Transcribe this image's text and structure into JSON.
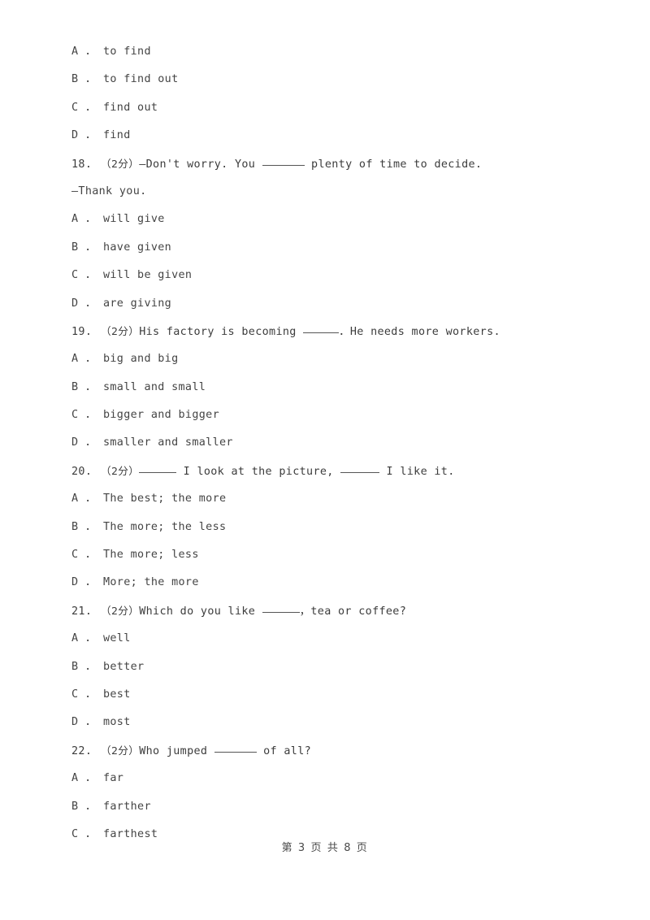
{
  "document": {
    "page_label": "第 3 页 共 8 页",
    "page_number": 3,
    "total_pages": 8,
    "text_color": "#444444",
    "background_color": "#ffffff"
  },
  "lines": [
    {
      "id": "l1",
      "kind": "option",
      "text": "A ． to find"
    },
    {
      "id": "l2",
      "kind": "option",
      "text": "B ． to find out"
    },
    {
      "id": "l3",
      "kind": "option",
      "text": "C ． find out"
    },
    {
      "id": "l4",
      "kind": "option",
      "text": "D ． find"
    },
    {
      "id": "l5",
      "kind": "question",
      "number": "18.",
      "marks": "（2分）",
      "pre": "—Don't worry. You ",
      "blank": "w1",
      "post": " plenty of time to decide."
    },
    {
      "id": "l6",
      "kind": "text",
      "text": "—Thank you."
    },
    {
      "id": "l7",
      "kind": "option",
      "text": "A ． will give"
    },
    {
      "id": "l8",
      "kind": "option",
      "text": "B ． have given"
    },
    {
      "id": "l9",
      "kind": "option",
      "text": "C ． will be given"
    },
    {
      "id": "l10",
      "kind": "option",
      "text": "D ． are giving"
    },
    {
      "id": "l11",
      "kind": "question",
      "number": "19.",
      "marks": "（2分）",
      "pre": "His factory is becoming ",
      "blank": "w2",
      "post": "．He needs more workers."
    },
    {
      "id": "l12",
      "kind": "option",
      "text": "A ． big and big"
    },
    {
      "id": "l13",
      "kind": "option",
      "text": "B ． small and small"
    },
    {
      "id": "l14",
      "kind": "option",
      "text": "C ． bigger and bigger"
    },
    {
      "id": "l15",
      "kind": "option",
      "text": "D ． smaller and smaller"
    },
    {
      "id": "l16",
      "kind": "question2",
      "number": "20.",
      "marks": "（2分）",
      "pre": "",
      "blank": "w3",
      "mid": " I look at the picture, ",
      "blank2": "w4",
      "post": " I like it."
    },
    {
      "id": "l17",
      "kind": "option",
      "text": "A ． The best; the more"
    },
    {
      "id": "l18",
      "kind": "option",
      "text": "B ． The more; the less"
    },
    {
      "id": "l19",
      "kind": "option",
      "text": "C ． The more; less"
    },
    {
      "id": "l20",
      "kind": "option",
      "text": "D ． More; the more"
    },
    {
      "id": "l21",
      "kind": "question",
      "number": "21.",
      "marks": "（2分）",
      "pre": "Which do you like ",
      "blank": "w3",
      "post": "，tea or coffee?"
    },
    {
      "id": "l22",
      "kind": "option",
      "text": "A ． well"
    },
    {
      "id": "l23",
      "kind": "option",
      "text": "B ． better"
    },
    {
      "id": "l24",
      "kind": "option",
      "text": "C ． best"
    },
    {
      "id": "l25",
      "kind": "option",
      "text": "D ． most"
    },
    {
      "id": "l26",
      "kind": "question",
      "number": "22.",
      "marks": "（2分）",
      "pre": "Who jumped ",
      "blank": "w1",
      "post": " of all?"
    },
    {
      "id": "l27",
      "kind": "option",
      "text": "A ． far"
    },
    {
      "id": "l28",
      "kind": "option",
      "text": "B ． farther"
    },
    {
      "id": "l29",
      "kind": "option",
      "text": "C ． farthest"
    }
  ],
  "questions": [
    {
      "number": "18.",
      "marks": "（2分）",
      "stem": "—Don't worry. You ______ plenty of time to decide.",
      "stem_line2": "—Thank you.",
      "options": [
        {
          "letter": "A",
          "text": "will give"
        },
        {
          "letter": "B",
          "text": "have given"
        },
        {
          "letter": "C",
          "text": "will be given"
        },
        {
          "letter": "D",
          "text": "are giving"
        }
      ]
    },
    {
      "number": "19.",
      "marks": "（2分）",
      "stem": "His factory is becoming ______．He needs more workers.",
      "options": [
        {
          "letter": "A",
          "text": "big and big"
        },
        {
          "letter": "B",
          "text": "small and small"
        },
        {
          "letter": "C",
          "text": "bigger and bigger"
        },
        {
          "letter": "D",
          "text": "smaller and smaller"
        }
      ]
    },
    {
      "number": "20.",
      "marks": "（2分）",
      "stem": "______ I look at the picture, ______ I like it.",
      "options": [
        {
          "letter": "A",
          "text": "The best; the more"
        },
        {
          "letter": "B",
          "text": "The more; the less"
        },
        {
          "letter": "C",
          "text": "The more; less"
        },
        {
          "letter": "D",
          "text": "More; the more"
        }
      ]
    },
    {
      "number": "21.",
      "marks": "（2分）",
      "stem": "Which do you like ______，tea or coffee?",
      "options": [
        {
          "letter": "A",
          "text": "well"
        },
        {
          "letter": "B",
          "text": "better"
        },
        {
          "letter": "C",
          "text": "best"
        },
        {
          "letter": "D",
          "text": "most"
        }
      ]
    },
    {
      "number": "22.",
      "marks": "（2分）",
      "stem": "Who jumped ______ of all?",
      "options": [
        {
          "letter": "A",
          "text": "far"
        },
        {
          "letter": "B",
          "text": "farther"
        },
        {
          "letter": "C",
          "text": "farthest"
        }
      ]
    }
  ],
  "previous_question_options": [
    {
      "letter": "A",
      "text": "to find"
    },
    {
      "letter": "B",
      "text": "to find out"
    },
    {
      "letter": "C",
      "text": "find out"
    },
    {
      "letter": "D",
      "text": "find"
    }
  ]
}
